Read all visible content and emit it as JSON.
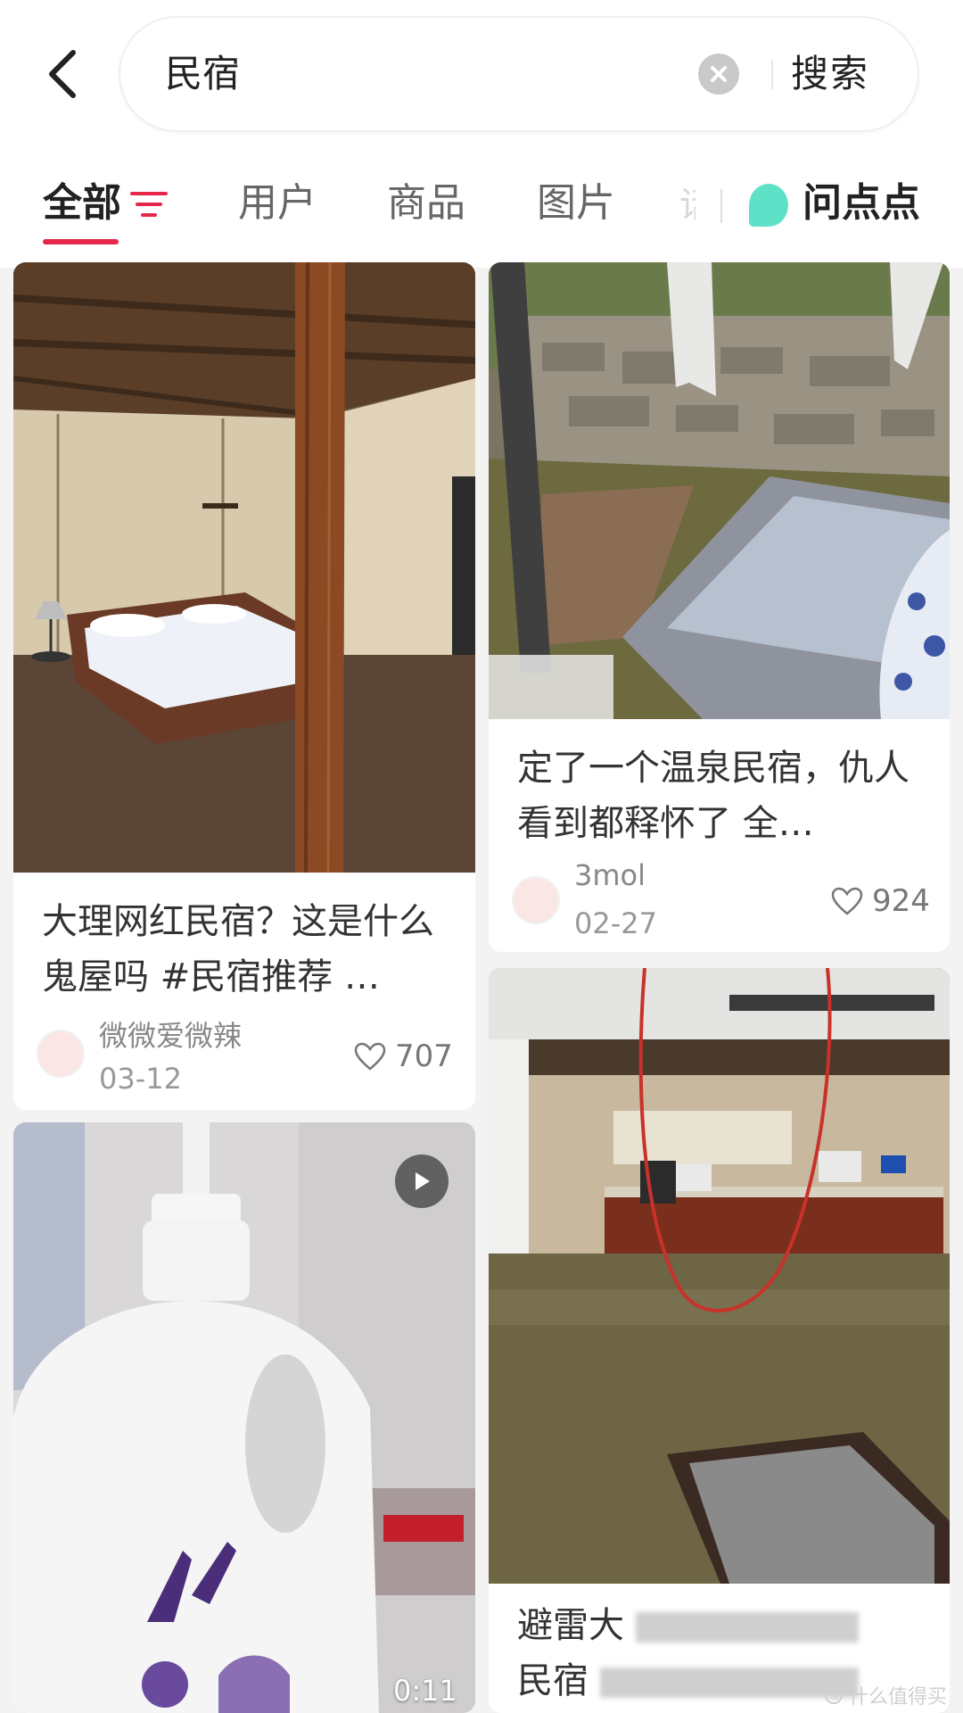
{
  "search": {
    "query": "民宿",
    "button_label": "搜索"
  },
  "tabs": [
    {
      "label": "全部"
    },
    {
      "label": "用户"
    },
    {
      "label": "商品"
    },
    {
      "label": "图片"
    }
  ],
  "tab_fade": "话",
  "assistant_tab": {
    "label": "问点点"
  },
  "cards": [
    {
      "title": "大理网红民宿？这是什么鬼屋吗 #民宿推荐 …",
      "author": "微微爱微辣",
      "date": "03-12",
      "likes": "707"
    },
    {
      "title": "定了一个温泉民宿，仇人看到都释怀了 全…",
      "author": "3mol",
      "date": "02-27",
      "likes": "924"
    },
    {
      "duration": "0:11"
    },
    {
      "title_line1": "避雷大",
      "title_line2": "民宿"
    }
  ],
  "watermark": "什么值得买",
  "colors": {
    "accent": "#e5284a",
    "assistant": "#5fe1c7"
  }
}
